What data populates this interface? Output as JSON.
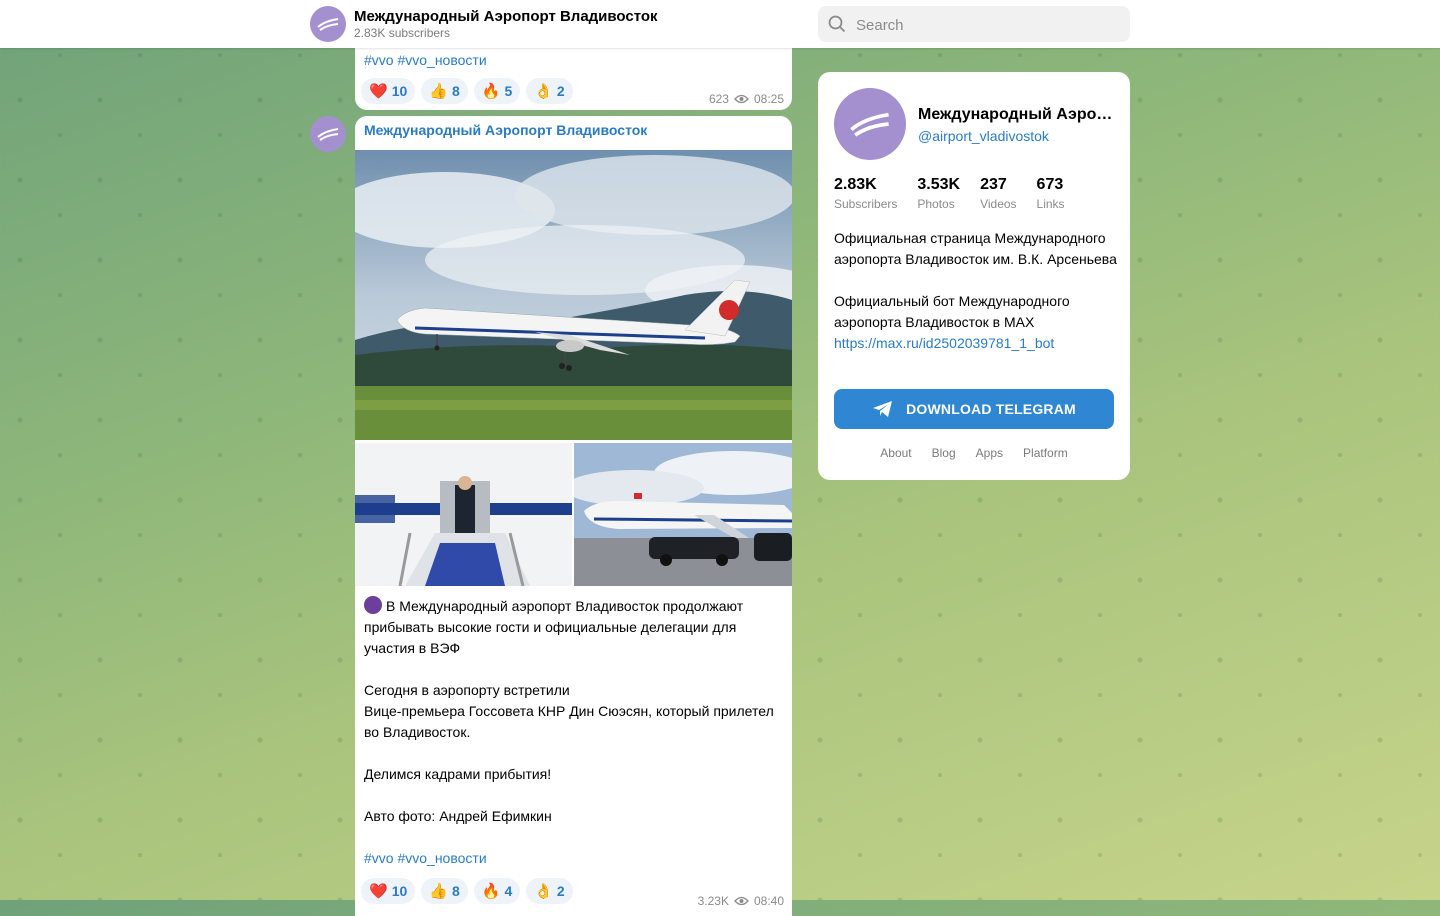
{
  "header": {
    "channel_name": "Международный Аэропорт Владивосток",
    "subscribers": "2.83K subscribers",
    "search_placeholder": "Search"
  },
  "feed": {
    "prev_post": {
      "tags": "#vvo #vvo_новости",
      "reactions": [
        {
          "emoji": "❤️",
          "count": "10"
        },
        {
          "emoji": "👍",
          "count": "8"
        },
        {
          "emoji": "🔥",
          "count": "5"
        },
        {
          "emoji": "👌",
          "count": "2"
        }
      ],
      "views": "623",
      "time": "08:25"
    },
    "post": {
      "author": "Международный Аэропорт Владивосток",
      "text_1": "В Международный аэропорт Владивосток продолжают прибывать высокие гости и официальные делегации для участия в ВЭФ",
      "text_2": "Сегодня в аэропорту встретили\nВице-премьера Госсовета КНР Дин Сюэсян, который прилетел во Владивосток.",
      "text_3": "Делимся кадрами прибытия!",
      "text_4": "Авто фото: Андрей Ефимкин",
      "tags": "#vvo #vvo_новости",
      "reactions": [
        {
          "emoji": "❤️",
          "count": "10"
        },
        {
          "emoji": "👍",
          "count": "8"
        },
        {
          "emoji": "🔥",
          "count": "4"
        },
        {
          "emoji": "👌",
          "count": "2"
        }
      ],
      "views": "3.23K",
      "time": "08:40"
    }
  },
  "card": {
    "name": "Международный Аэропорт Владивосток",
    "handle": "@airport_vladivostok",
    "stats": [
      {
        "num": "2.83K",
        "label": "Subscribers"
      },
      {
        "num": "3.53K",
        "label": "Photos"
      },
      {
        "num": "237",
        "label": "Videos"
      },
      {
        "num": "673",
        "label": "Links"
      }
    ],
    "desc_1": "Официальная страница Международного аэропорта Владивосток им. В.К. Арсеньева",
    "desc_2": "Официальный бот Международного аэропорта Владивосток в MAX",
    "link": "https://max.ru/id2502039781_1_bot",
    "download_label": "DOWNLOAD TELEGRAM",
    "footer": [
      "About",
      "Blog",
      "Apps",
      "Platform"
    ]
  },
  "colors": {
    "accent": "#2b7bc1",
    "button": "#2f86d2",
    "avatar": "#a48fcf"
  }
}
